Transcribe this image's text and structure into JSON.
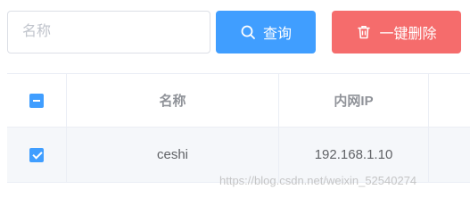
{
  "search": {
    "placeholder": "名称",
    "value": ""
  },
  "toolbar": {
    "query_label": "查询",
    "query_icon": "search-icon",
    "delete_label": "一键删除",
    "delete_icon": "trash-icon"
  },
  "colors": {
    "primary": "#409eff",
    "danger": "#f56c6c",
    "border": "#ebeef5",
    "header_text": "#909399"
  },
  "table": {
    "columns": [
      "",
      "名称",
      "内网IP",
      ""
    ],
    "header_checkbox": "indeterminate",
    "rows": [
      {
        "checked": true,
        "name": "ceshi",
        "ip": "192.168.1.10"
      }
    ]
  },
  "watermark": "https://blog.csdn.net/weixin_52540274"
}
